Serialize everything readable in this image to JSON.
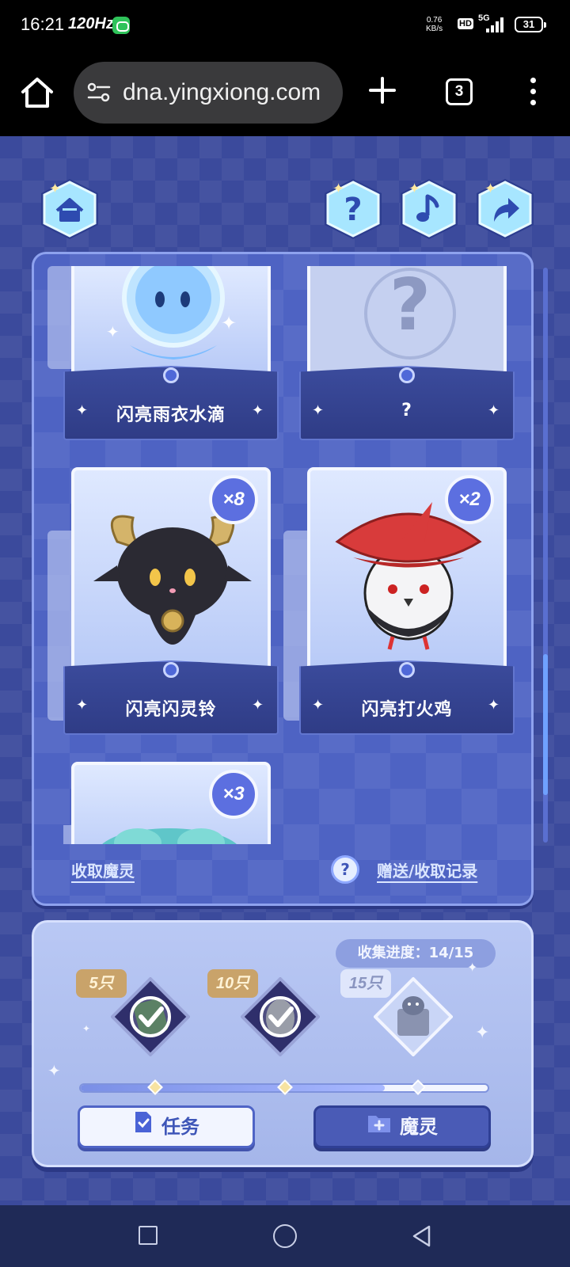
{
  "status_bar": {
    "time": "16:21",
    "refresh_rate": "120Hz",
    "net_speed": "0.76",
    "net_speed_unit": "KB/s",
    "hd": "HD",
    "network": "5G",
    "battery": "31"
  },
  "browser": {
    "url": "dna.yingxiong.com",
    "tab_count": "3"
  },
  "cards": [
    {
      "name": "闪亮雨衣水滴",
      "count": null
    },
    {
      "name": "?",
      "count": null
    },
    {
      "name": "闪亮闪灵铃",
      "count": "×8"
    },
    {
      "name": "闪亮打火鸡",
      "count": "×2"
    },
    {
      "name": "",
      "count": "×3"
    }
  ],
  "links": {
    "receive": "收取魔灵",
    "records": "赠送/收取记录",
    "records_help": "?"
  },
  "progress": {
    "label": "收集进度：",
    "value": "14/15",
    "collected": 14,
    "total": 15,
    "milestones": [
      {
        "tag": "5只",
        "threshold": 5,
        "claimed": true
      },
      {
        "tag": "10只",
        "threshold": 10,
        "claimed": true
      },
      {
        "tag": "15只",
        "threshold": 15,
        "claimed": false
      }
    ]
  },
  "buttons": {
    "task": "任务",
    "spirit": "魔灵"
  },
  "colors": {
    "page_bg": "#3b4a9c",
    "panel": "#4e63c3",
    "accent": "#5c6fe0",
    "claimed_tag": "#c9a36a",
    "unclaimed_tag": "#dfe6fb"
  }
}
